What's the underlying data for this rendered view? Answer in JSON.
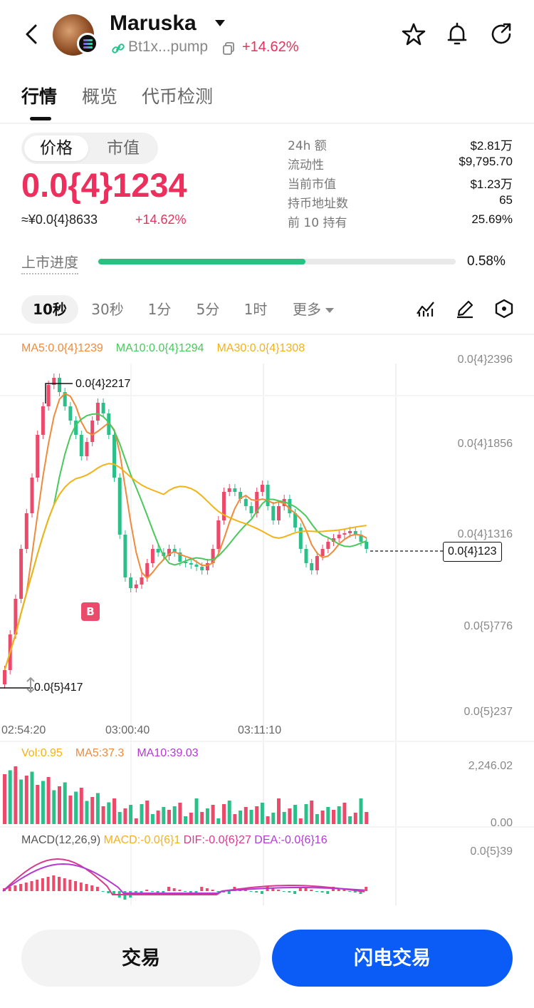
{
  "header": {
    "back_icon": "chevron-left-icon",
    "token_name": "Maruska",
    "address": "Bt1x...pump",
    "change": "+14.62%",
    "icons": [
      "star-icon",
      "bell-icon",
      "share-icon"
    ]
  },
  "tabs": [
    {
      "label": "行情",
      "active": true
    },
    {
      "label": "概览",
      "active": false
    },
    {
      "label": "代币检测",
      "active": false
    }
  ],
  "price_panel": {
    "segments": [
      "价格",
      "市值"
    ],
    "active_segment": "价格",
    "price": "0.0{4}1234",
    "cny_price": "≈¥0.0{4}8633",
    "change": "+14.62%"
  },
  "stats": [
    {
      "label": "24h  额",
      "value": "$2.81万"
    },
    {
      "label": "流动性",
      "value": "$9,795.70"
    },
    {
      "label": "当前市值",
      "value": "$1.23万"
    },
    {
      "label": "持币地址数",
      "value": "65"
    },
    {
      "label": "前 10 持有",
      "value": "25.69%"
    }
  ],
  "listing_progress": {
    "label": "上市进度",
    "value": "0.58%",
    "fill_fraction": 0.58
  },
  "intervals": {
    "items": [
      "10秒",
      "30秒",
      "1分",
      "5分",
      "1时"
    ],
    "active": "10秒",
    "more": "更多",
    "tools": [
      "indicator-icon",
      "draw-pen-icon",
      "settings-hexagon-icon"
    ]
  },
  "chart_legend": {
    "ma5": "MA5:0.0{4}1239",
    "ma10": "MA10:0.0{4}1294",
    "ma30": "MA30:0.0{4}1308"
  },
  "price_axis": [
    "0.0{4}2396",
    "0.0{4}1856",
    "0.0{4}1316",
    "0.0{5}776",
    "0.0{5}237"
  ],
  "time_axis": [
    "02:54:20",
    "03:00:40",
    "03:11:10"
  ],
  "chart_marks": {
    "high": "0.0{4}2217",
    "low": "0.0{5}417",
    "current": "0.0{4}123",
    "buy_marker": "B"
  },
  "volume": {
    "vol": "Vol:0.95",
    "ma5": "MA5:37.3",
    "ma10": "MA10:39.03",
    "axis_top": "2,246.02",
    "axis_bottom": "0.00"
  },
  "macd": {
    "title": "MACD(12,26,9)",
    "macd": "MACD:-0.0{6}1",
    "dif": "DIF:-0.0{6}27",
    "dea": "DEA:-0.0{6}16",
    "axis_top": "0.0{5}39"
  },
  "colors": {
    "up": "#ec4a6b",
    "down": "#2bbf8a",
    "ma5": "#f08a3c",
    "ma10": "#49c95c",
    "ma30": "#f2b316",
    "flash_button": "#0b5cf6"
  },
  "buttons": {
    "trade": "交易",
    "flash_trade": "闪电交易"
  }
}
